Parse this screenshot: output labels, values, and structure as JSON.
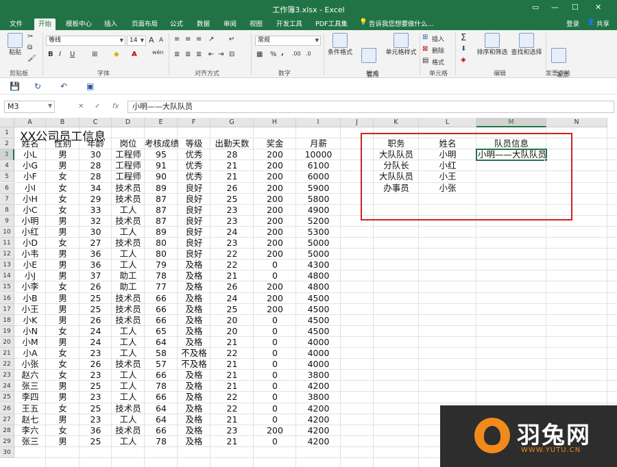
{
  "window": {
    "title": "工作簿3.xlsx - Excel",
    "controls": {
      "ribbon_options": "▭",
      "minimize": "—",
      "maximize": "☐",
      "close": "✕"
    }
  },
  "tabs": [
    "文件",
    "开始",
    "模板中心",
    "插入",
    "页面布局",
    "公式",
    "数据",
    "审阅",
    "视图",
    "开发工具",
    "PDF工具集"
  ],
  "active_tab_index": 1,
  "tell_me": "告诉我您想要做什么...",
  "login": "登录",
  "share": "共享",
  "ribbon": {
    "clipboard": {
      "paste": "粘贴",
      "label": "剪贴板"
    },
    "font": {
      "name": "等线",
      "size": "14",
      "grow": "A",
      "shrink": "A",
      "bold": "B",
      "italic": "I",
      "underline": "U",
      "wen": "wén",
      "label": "字体"
    },
    "alignment": {
      "label": "对齐方式"
    },
    "number": {
      "format": "常规",
      "percent": "%",
      "comma": ",",
      "label": "数字"
    },
    "styles": {
      "conditional": "条件格式",
      "table_format": "套用\n表格格式",
      "cell_styles": "单元格样式",
      "label": "样式"
    },
    "cells": {
      "insert": "插入",
      "delete": "删除",
      "format": "格式",
      "label": "单元格"
    },
    "editing": {
      "sort_filter": "排序和筛选",
      "find_select": "查找和选择",
      "label": "编辑"
    },
    "invoice": {
      "check": "发票\n查验",
      "label": "发票查验"
    }
  },
  "formula_bar": {
    "name_box": "M3",
    "formula": "小明——大队队员",
    "fx": "fx"
  },
  "columns": [
    "A",
    "B",
    "C",
    "D",
    "E",
    "F",
    "G",
    "H",
    "I",
    "J",
    "K",
    "L",
    "M",
    "N"
  ],
  "selected_column": "M",
  "selected_row": 3,
  "sheet": {
    "title": "XX公司员工信息",
    "headers": [
      "姓名",
      "性别",
      "年龄",
      "岗位",
      "考核成绩",
      "等级",
      "出勤天数",
      "奖金",
      "月薪"
    ],
    "rows": [
      [
        "小L",
        "男",
        "30",
        "工程师",
        "95",
        "优秀",
        "28",
        "200",
        "10000"
      ],
      [
        "小G",
        "男",
        "28",
        "工程师",
        "91",
        "优秀",
        "21",
        "200",
        "6100"
      ],
      [
        "小F",
        "女",
        "28",
        "工程师",
        "90",
        "优秀",
        "21",
        "200",
        "6000"
      ],
      [
        "小I",
        "女",
        "34",
        "技术员",
        "89",
        "良好",
        "26",
        "200",
        "5900"
      ],
      [
        "小H",
        "女",
        "29",
        "技术员",
        "87",
        "良好",
        "25",
        "200",
        "5800"
      ],
      [
        "小C",
        "女",
        "33",
        "工人",
        "87",
        "良好",
        "23",
        "200",
        "4900"
      ],
      [
        "小明",
        "男",
        "32",
        "技术员",
        "87",
        "良好",
        "23",
        "200",
        "5200"
      ],
      [
        "小红",
        "男",
        "30",
        "工人",
        "89",
        "良好",
        "24",
        "200",
        "5300"
      ],
      [
        "小D",
        "女",
        "27",
        "技术员",
        "80",
        "良好",
        "23",
        "200",
        "5000"
      ],
      [
        "小韦",
        "男",
        "36",
        "工人",
        "80",
        "良好",
        "22",
        "200",
        "5000"
      ],
      [
        "小E",
        "男",
        "36",
        "工人",
        "79",
        "及格",
        "22",
        "0",
        "4300"
      ],
      [
        "小J",
        "男",
        "37",
        "助工",
        "78",
        "及格",
        "21",
        "0",
        "4800"
      ],
      [
        "小李",
        "女",
        "26",
        "助工",
        "77",
        "及格",
        "26",
        "200",
        "4800"
      ],
      [
        "小B",
        "男",
        "25",
        "技术员",
        "66",
        "及格",
        "24",
        "200",
        "4500"
      ],
      [
        "小王",
        "男",
        "25",
        "技术员",
        "66",
        "及格",
        "25",
        "200",
        "4500"
      ],
      [
        "小K",
        "男",
        "26",
        "技术员",
        "66",
        "及格",
        "20",
        "0",
        "4500"
      ],
      [
        "小N",
        "女",
        "24",
        "工人",
        "65",
        "及格",
        "20",
        "0",
        "4500"
      ],
      [
        "小M",
        "男",
        "24",
        "工人",
        "64",
        "及格",
        "21",
        "0",
        "4000"
      ],
      [
        "小A",
        "女",
        "23",
        "工人",
        "58",
        "不及格",
        "22",
        "0",
        "4000"
      ],
      [
        "小张",
        "女",
        "26",
        "技术员",
        "57",
        "不及格",
        "21",
        "0",
        "4000"
      ],
      [
        "赵六",
        "女",
        "23",
        "工人",
        "66",
        "及格",
        "21",
        "0",
        "3800"
      ],
      [
        "张三",
        "男",
        "25",
        "工人",
        "78",
        "及格",
        "21",
        "0",
        "4200"
      ],
      [
        "李四",
        "男",
        "23",
        "工人",
        "66",
        "及格",
        "22",
        "0",
        "3800"
      ],
      [
        "王五",
        "女",
        "25",
        "技术员",
        "64",
        "及格",
        "22",
        "0",
        "4200"
      ],
      [
        "赵七",
        "男",
        "23",
        "工人",
        "64",
        "及格",
        "21",
        "0",
        "4200"
      ],
      [
        "李六",
        "女",
        "36",
        "技术员",
        "66",
        "及格",
        "23",
        "200",
        "4200"
      ],
      [
        "张三",
        "男",
        "25",
        "工人",
        "78",
        "及格",
        "21",
        "0",
        "4200"
      ]
    ],
    "side_headers": [
      "职务",
      "姓名",
      "队员信息"
    ],
    "side_rows": [
      [
        "大队队员",
        "小明",
        "小明——大队队员"
      ],
      [
        "分队长",
        "小红",
        ""
      ],
      [
        "大队队员",
        "小王",
        ""
      ],
      [
        "办事员",
        "小张",
        ""
      ]
    ]
  },
  "watermark": {
    "name": "羽兔网",
    "url": "WWW.YUTU.CN"
  }
}
